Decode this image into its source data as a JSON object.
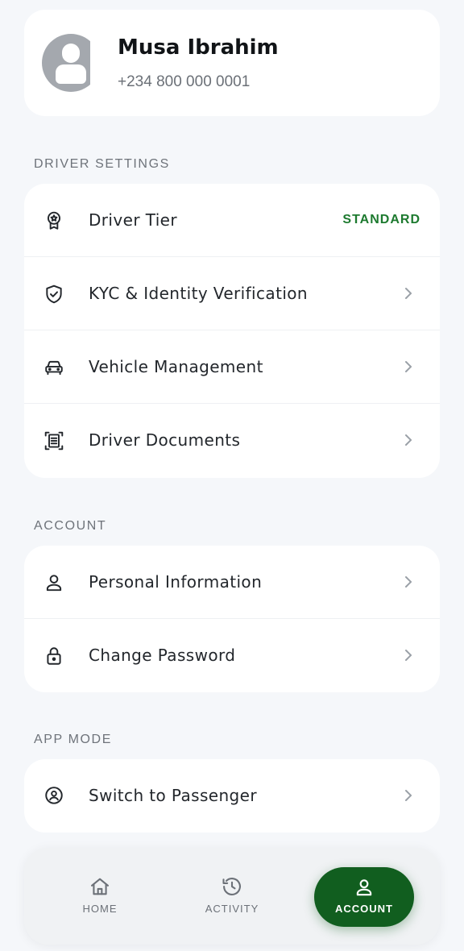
{
  "profile": {
    "name": "Musa Ibrahim",
    "phone": "+234 800 000 0001"
  },
  "driver_settings": {
    "heading": "DRIVER SETTINGS",
    "items": [
      {
        "label": "Driver Tier",
        "value": "STANDARD",
        "icon": "badge-icon"
      },
      {
        "label": "KYC & Identity Verification",
        "icon": "shield-check-icon"
      },
      {
        "label": "Vehicle Management",
        "icon": "car-icon"
      },
      {
        "label": "Driver Documents",
        "icon": "document-scan-icon"
      }
    ]
  },
  "account": {
    "heading": "ACCOUNT",
    "items": [
      {
        "label": "Personal Information",
        "icon": "person-icon"
      },
      {
        "label": "Change Password",
        "icon": "lock-icon"
      }
    ]
  },
  "app_mode": {
    "heading": "APP MODE",
    "items": [
      {
        "label": "Switch to Passenger",
        "icon": "location-person-icon"
      }
    ]
  },
  "bottom_nav": {
    "items": [
      {
        "label": "HOME",
        "icon": "home-icon"
      },
      {
        "label": "ACTIVITY",
        "icon": "history-icon"
      },
      {
        "label": "ACCOUNT",
        "icon": "person-icon",
        "active": true
      }
    ]
  },
  "colors": {
    "accent": "#115e1f",
    "tier_text": "#1d7a2f",
    "background": "#f5f7fa"
  }
}
